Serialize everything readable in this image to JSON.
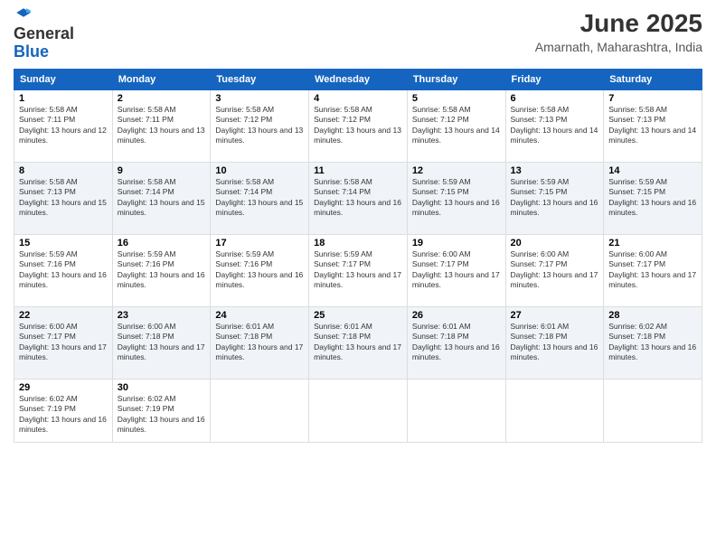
{
  "logo": {
    "general": "General",
    "blue": "Blue"
  },
  "title": "June 2025",
  "location": "Amarnath, Maharashtra, India",
  "days_of_week": [
    "Sunday",
    "Monday",
    "Tuesday",
    "Wednesday",
    "Thursday",
    "Friday",
    "Saturday"
  ],
  "weeks": [
    [
      {
        "day": 1,
        "sunrise": "5:58 AM",
        "sunset": "7:11 PM",
        "daylight": "13 hours and 12 minutes."
      },
      {
        "day": 2,
        "sunrise": "5:58 AM",
        "sunset": "7:11 PM",
        "daylight": "13 hours and 13 minutes."
      },
      {
        "day": 3,
        "sunrise": "5:58 AM",
        "sunset": "7:12 PM",
        "daylight": "13 hours and 13 minutes."
      },
      {
        "day": 4,
        "sunrise": "5:58 AM",
        "sunset": "7:12 PM",
        "daylight": "13 hours and 13 minutes."
      },
      {
        "day": 5,
        "sunrise": "5:58 AM",
        "sunset": "7:12 PM",
        "daylight": "13 hours and 14 minutes."
      },
      {
        "day": 6,
        "sunrise": "5:58 AM",
        "sunset": "7:13 PM",
        "daylight": "13 hours and 14 minutes."
      },
      {
        "day": 7,
        "sunrise": "5:58 AM",
        "sunset": "7:13 PM",
        "daylight": "13 hours and 14 minutes."
      }
    ],
    [
      {
        "day": 8,
        "sunrise": "5:58 AM",
        "sunset": "7:13 PM",
        "daylight": "13 hours and 15 minutes."
      },
      {
        "day": 9,
        "sunrise": "5:58 AM",
        "sunset": "7:14 PM",
        "daylight": "13 hours and 15 minutes."
      },
      {
        "day": 10,
        "sunrise": "5:58 AM",
        "sunset": "7:14 PM",
        "daylight": "13 hours and 15 minutes."
      },
      {
        "day": 11,
        "sunrise": "5:58 AM",
        "sunset": "7:14 PM",
        "daylight": "13 hours and 16 minutes."
      },
      {
        "day": 12,
        "sunrise": "5:59 AM",
        "sunset": "7:15 PM",
        "daylight": "13 hours and 16 minutes."
      },
      {
        "day": 13,
        "sunrise": "5:59 AM",
        "sunset": "7:15 PM",
        "daylight": "13 hours and 16 minutes."
      },
      {
        "day": 14,
        "sunrise": "5:59 AM",
        "sunset": "7:15 PM",
        "daylight": "13 hours and 16 minutes."
      }
    ],
    [
      {
        "day": 15,
        "sunrise": "5:59 AM",
        "sunset": "7:16 PM",
        "daylight": "13 hours and 16 minutes."
      },
      {
        "day": 16,
        "sunrise": "5:59 AM",
        "sunset": "7:16 PM",
        "daylight": "13 hours and 16 minutes."
      },
      {
        "day": 17,
        "sunrise": "5:59 AM",
        "sunset": "7:16 PM",
        "daylight": "13 hours and 16 minutes."
      },
      {
        "day": 18,
        "sunrise": "5:59 AM",
        "sunset": "7:17 PM",
        "daylight": "13 hours and 17 minutes."
      },
      {
        "day": 19,
        "sunrise": "6:00 AM",
        "sunset": "7:17 PM",
        "daylight": "13 hours and 17 minutes."
      },
      {
        "day": 20,
        "sunrise": "6:00 AM",
        "sunset": "7:17 PM",
        "daylight": "13 hours and 17 minutes."
      },
      {
        "day": 21,
        "sunrise": "6:00 AM",
        "sunset": "7:17 PM",
        "daylight": "13 hours and 17 minutes."
      }
    ],
    [
      {
        "day": 22,
        "sunrise": "6:00 AM",
        "sunset": "7:17 PM",
        "daylight": "13 hours and 17 minutes."
      },
      {
        "day": 23,
        "sunrise": "6:00 AM",
        "sunset": "7:18 PM",
        "daylight": "13 hours and 17 minutes."
      },
      {
        "day": 24,
        "sunrise": "6:01 AM",
        "sunset": "7:18 PM",
        "daylight": "13 hours and 17 minutes."
      },
      {
        "day": 25,
        "sunrise": "6:01 AM",
        "sunset": "7:18 PM",
        "daylight": "13 hours and 17 minutes."
      },
      {
        "day": 26,
        "sunrise": "6:01 AM",
        "sunset": "7:18 PM",
        "daylight": "13 hours and 16 minutes."
      },
      {
        "day": 27,
        "sunrise": "6:01 AM",
        "sunset": "7:18 PM",
        "daylight": "13 hours and 16 minutes."
      },
      {
        "day": 28,
        "sunrise": "6:02 AM",
        "sunset": "7:18 PM",
        "daylight": "13 hours and 16 minutes."
      }
    ],
    [
      {
        "day": 29,
        "sunrise": "6:02 AM",
        "sunset": "7:19 PM",
        "daylight": "13 hours and 16 minutes."
      },
      {
        "day": 30,
        "sunrise": "6:02 AM",
        "sunset": "7:19 PM",
        "daylight": "13 hours and 16 minutes."
      },
      null,
      null,
      null,
      null,
      null
    ]
  ]
}
